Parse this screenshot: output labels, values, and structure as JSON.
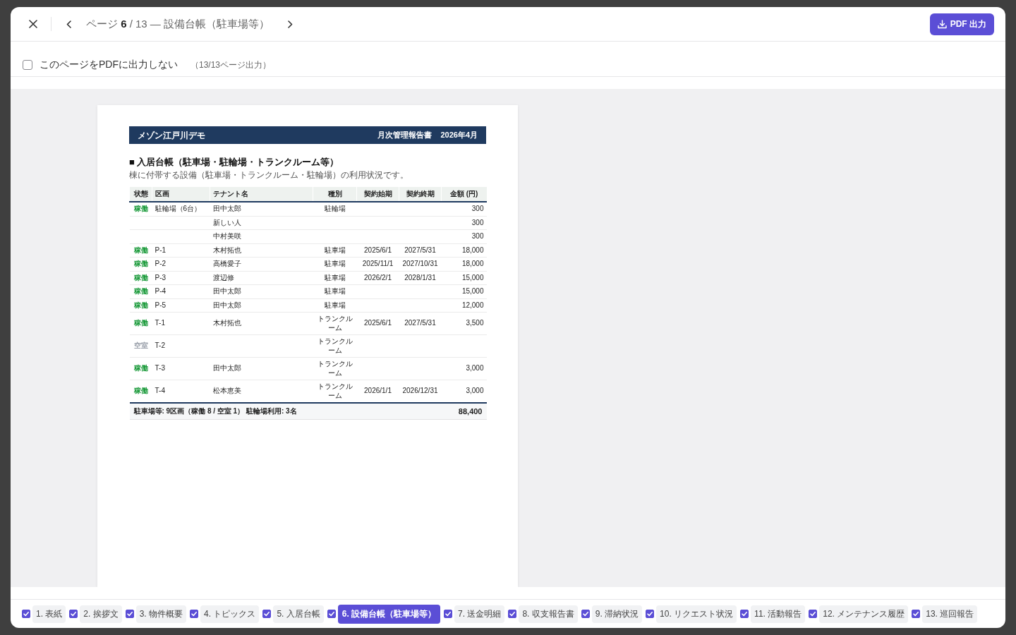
{
  "header": {
    "title": "ページ **6** / 13 — 設備台帳（駐車場等）",
    "export_button": "PDF 出力"
  },
  "exclude_option": {
    "label": "このページをPDFに出力しない",
    "checked": false,
    "count": "（13/13ページ出力）"
  },
  "document": {
    "property": "メゾン江戸川デモ",
    "report_title": "月次管理報告書",
    "period": "2026年4月",
    "section_title": "■ 入居台帳（駐車場・駐輪場・トランクルーム等）",
    "description": "棟に付帯する設備（駐車場・トランクルーム・駐輪場）の利用状況です。",
    "table": {
      "columns": [
        "状態",
        "区画",
        "テナント名",
        "種別",
        "契約始期",
        "契約終期",
        "金額 (円)"
      ],
      "rows": [
        {
          "status": "稼働",
          "occupied": true,
          "lot": "駐輪場（6台）",
          "tenant": "田中太郎",
          "type": "駐輪場",
          "amount": "300"
        },
        {
          "tenant": "新しい人",
          "amount": "300"
        },
        {
          "tenant": "中村美咲",
          "amount": "300"
        },
        {
          "status": "稼働",
          "occupied": true,
          "lot": "P-1",
          "tenant": "木村拓也",
          "type": "駐車場",
          "start": "2025/6/1",
          "end": "2027/5/31",
          "amount": "18,000"
        },
        {
          "status": "稼働",
          "occupied": true,
          "lot": "P-2",
          "tenant": "高橋愛子",
          "type": "駐車場",
          "start": "2025/11/1",
          "end": "2027/10/31",
          "amount": "18,000"
        },
        {
          "status": "稼働",
          "occupied": true,
          "lot": "P-3",
          "tenant": "渡辺修",
          "type": "駐車場",
          "start": "2026/2/1",
          "end": "2028/1/31",
          "amount": "15,000"
        },
        {
          "status": "稼働",
          "occupied": true,
          "lot": "P-4",
          "tenant": "田中太郎",
          "type": "駐車場",
          "amount": "15,000"
        },
        {
          "status": "稼働",
          "occupied": true,
          "lot": "P-5",
          "tenant": "田中太郎",
          "type": "駐車場",
          "amount": "12,000"
        },
        {
          "status": "稼働",
          "occupied": true,
          "lot": "T-1",
          "tenant": "木村拓也",
          "type": "トランクルーム",
          "start": "2025/6/1",
          "end": "2027/5/31",
          "amount": "3,500"
        },
        {
          "status": "空室",
          "occupied": false,
          "lot": "T-2",
          "type": "トランクルーム"
        },
        {
          "status": "稼働",
          "occupied": true,
          "lot": "T-3",
          "tenant": "田中太郎",
          "type": "トランクルーム",
          "amount": "3,000"
        },
        {
          "status": "稼働",
          "occupied": true,
          "lot": "T-4",
          "tenant": "松本恵美",
          "type": "トランクルーム",
          "start": "2026/1/1",
          "end": "2026/12/31",
          "amount": "3,000"
        }
      ],
      "footer": {
        "summary": "駐車場等: 9区画（稼働 8 / 空室 1） 駐輪場利用: 3名",
        "total": "88,400"
      }
    }
  },
  "pages": [
    {
      "label": "1. 表紙",
      "checked": true,
      "selected": false
    },
    {
      "label": "2. 挨拶文",
      "checked": true,
      "selected": false
    },
    {
      "label": "3. 物件概要",
      "checked": true,
      "selected": false
    },
    {
      "label": "4. トピックス",
      "checked": true,
      "selected": false
    },
    {
      "label": "5. 入居台帳",
      "checked": true,
      "selected": false
    },
    {
      "label": "6. 設備台帳（駐車場等）",
      "checked": true,
      "selected": true
    },
    {
      "label": "7. 送金明細",
      "checked": true,
      "selected": false
    },
    {
      "label": "8. 収支報告書",
      "checked": true,
      "selected": false
    },
    {
      "label": "9. 滞納状況",
      "checked": true,
      "selected": false
    },
    {
      "label": "10. リクエスト状況",
      "checked": true,
      "selected": false
    },
    {
      "label": "11. 活動報告",
      "checked": true,
      "selected": false
    },
    {
      "label": "12. メンテナンス履歴",
      "checked": true,
      "selected": false
    },
    {
      "label": "13. 巡回報告",
      "checked": true,
      "selected": false
    }
  ]
}
